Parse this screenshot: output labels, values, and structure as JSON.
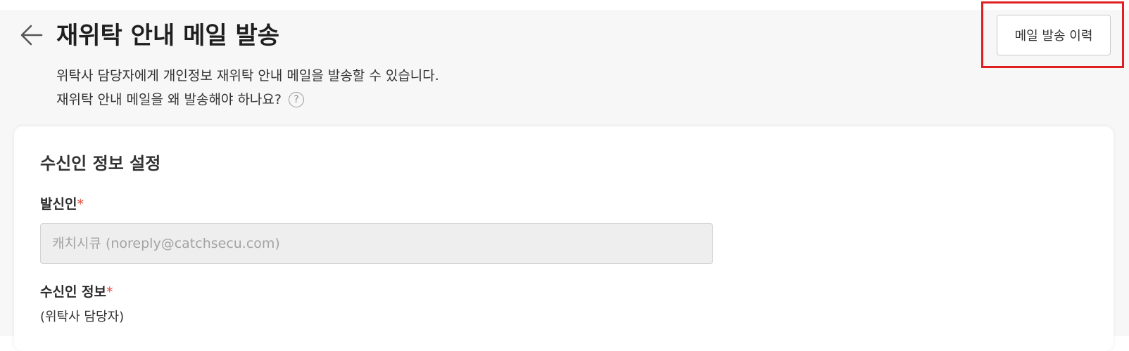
{
  "header": {
    "title": "재위탁 안내 메일 발송",
    "description_line1": "위탁사 담당자에게 개인정보 재위탁 안내 메일을 발송할 수 있습니다.",
    "description_line2": "재위탁 안내 메일을 왜 발송해야 하나요?",
    "help_icon_glyph": "?",
    "history_button_label": "메일 발송 이력",
    "back_icon": "arrow-left-icon"
  },
  "form": {
    "section_title": "수신인 정보 설정",
    "sender": {
      "label": "발신인",
      "required_mark": "*",
      "placeholder": "캐치시큐 (noreply@catchsecu.com)"
    },
    "recipient": {
      "label": "수신인 정보",
      "required_mark": "*",
      "sub_label": "(위탁사 담당자)"
    }
  },
  "colors": {
    "required": "#e24a3b",
    "highlight": "#e02020",
    "page_bg": "#f7f7f7"
  }
}
